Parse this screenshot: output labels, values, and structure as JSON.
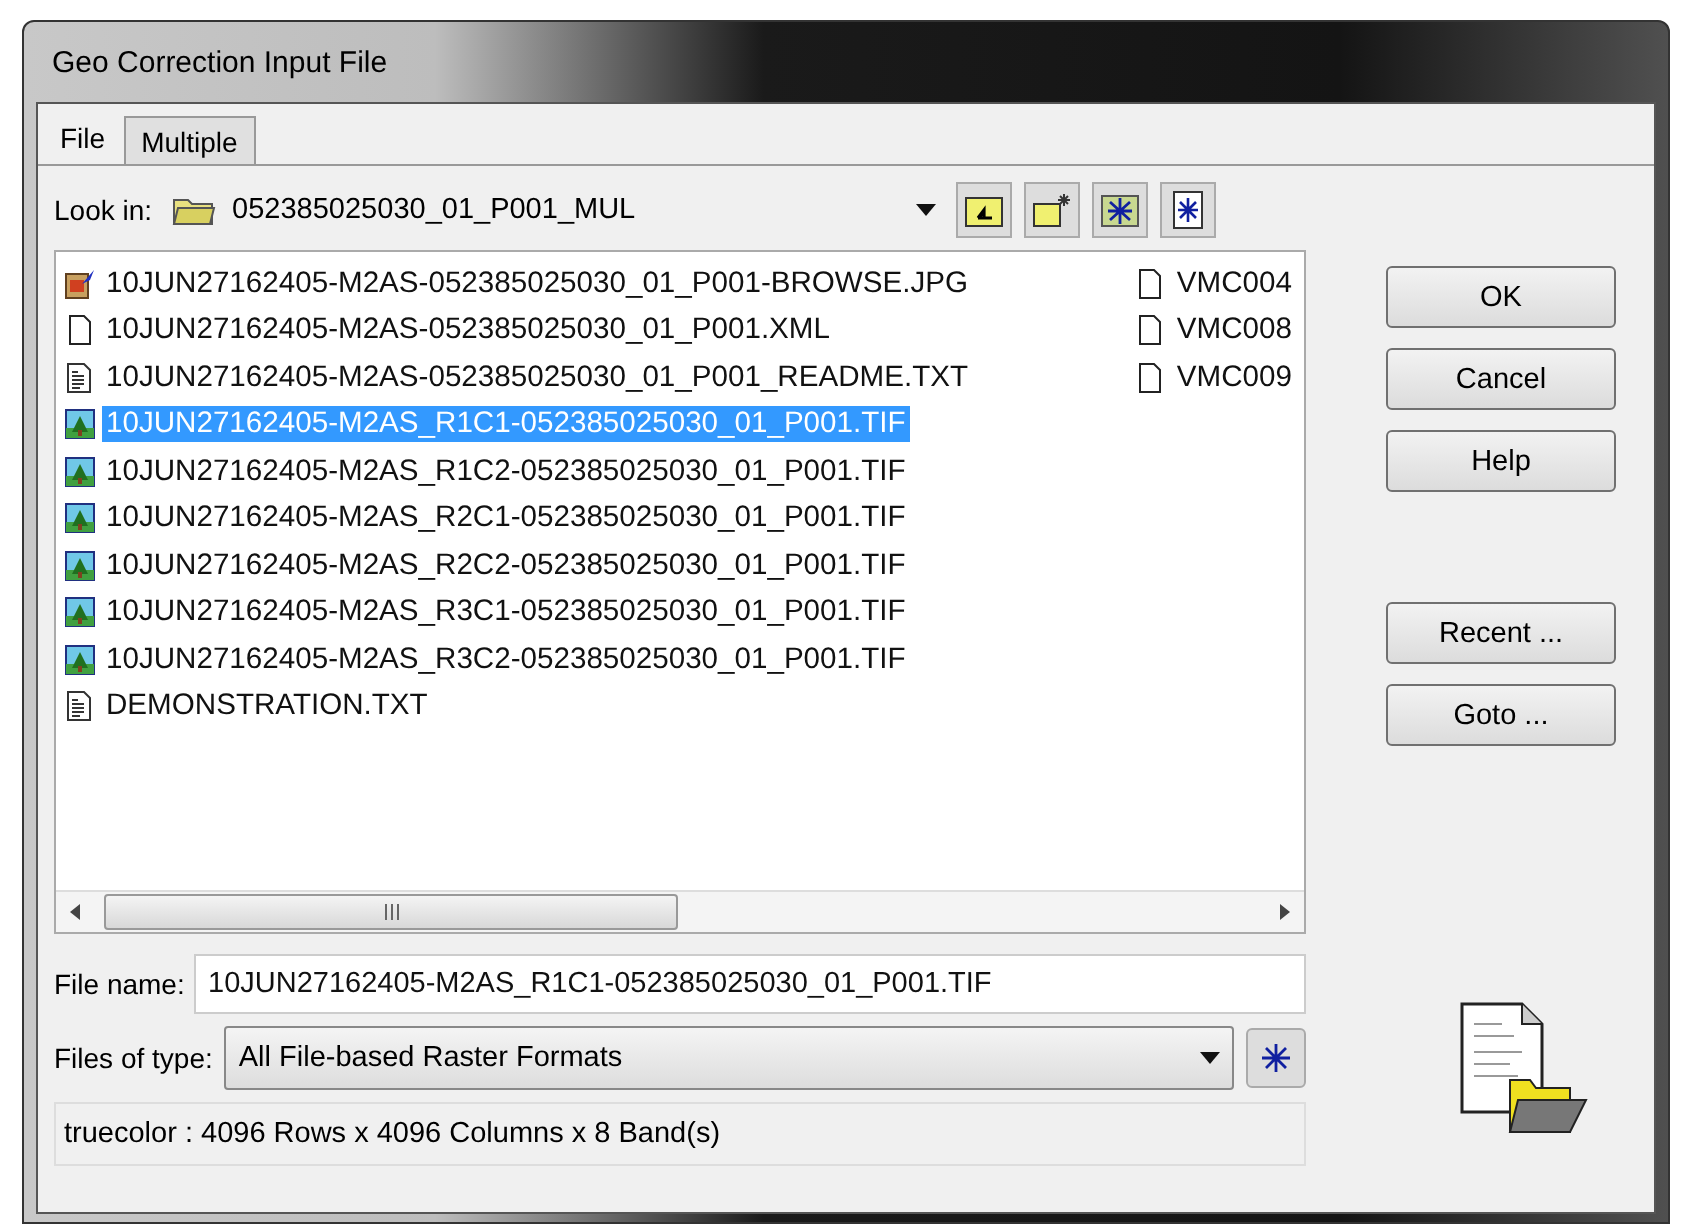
{
  "window": {
    "title": "Geo Correction Input File"
  },
  "tabs": [
    {
      "label": "File",
      "selected": true
    },
    {
      "label": "Multiple",
      "selected": false
    }
  ],
  "look_in": {
    "label": "Look in:",
    "value": "052385025030_01_P001_MUL"
  },
  "file_list": {
    "columns": [
      [
        {
          "name": "10JUN27162405-M2AS-052385025030_01_P001-BROWSE.JPG",
          "kind": "image",
          "selected": false
        },
        {
          "name": "10JUN27162405-M2AS-052385025030_01_P001.XML",
          "kind": "blank",
          "selected": false
        },
        {
          "name": "10JUN27162405-M2AS-052385025030_01_P001_README.TXT",
          "kind": "text",
          "selected": false
        },
        {
          "name": "10JUN27162405-M2AS_R1C1-052385025030_01_P001.TIF",
          "kind": "raster",
          "selected": true
        },
        {
          "name": "10JUN27162405-M2AS_R1C2-052385025030_01_P001.TIF",
          "kind": "raster",
          "selected": false
        },
        {
          "name": "10JUN27162405-M2AS_R2C1-052385025030_01_P001.TIF",
          "kind": "raster",
          "selected": false
        },
        {
          "name": "10JUN27162405-M2AS_R2C2-052385025030_01_P001.TIF",
          "kind": "raster",
          "selected": false
        },
        {
          "name": "10JUN27162405-M2AS_R3C1-052385025030_01_P001.TIF",
          "kind": "raster",
          "selected": false
        },
        {
          "name": "10JUN27162405-M2AS_R3C2-052385025030_01_P001.TIF",
          "kind": "raster",
          "selected": false
        },
        {
          "name": "DEMONSTRATION.TXT",
          "kind": "text",
          "selected": false
        }
      ],
      [
        {
          "name": "VMC004",
          "kind": "blank",
          "selected": false
        },
        {
          "name": "VMC008",
          "kind": "blank",
          "selected": false
        },
        {
          "name": "VMC009",
          "kind": "blank",
          "selected": false
        }
      ]
    ]
  },
  "file_name": {
    "label": "File name:",
    "value": "10JUN27162405-M2AS_R1C1-052385025030_01_P001.TIF"
  },
  "files_of_type": {
    "label": "Files of type:",
    "value": "All File-based Raster Formats"
  },
  "status": "truecolor : 4096 Rows x 4096 Columns x 8 Band(s)",
  "buttons": [
    "OK",
    "Cancel",
    "Help",
    "Recent ...",
    "Goto ..."
  ]
}
